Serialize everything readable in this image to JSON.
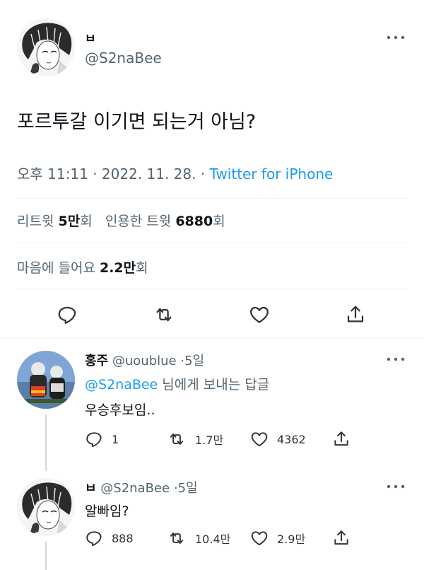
{
  "main_tweet": {
    "display_name": "ㅂ",
    "handle": "@S2naBee",
    "text": "포르투갈 이기면 되는거 아님?",
    "time": "오후 11:11",
    "sep1": "·",
    "date": "2022. 11. 28.",
    "sep2": "·",
    "source": "Twitter for iPhone",
    "retweets_label": "리트윗",
    "retweets_count": "5만",
    "retweets_suffix": "회",
    "quotes_label": "인용한 트윗",
    "quotes_count": "6880",
    "quotes_suffix": "회",
    "likes_label": "마음에 들어요",
    "likes_count": "2.2만",
    "likes_suffix": "회"
  },
  "reply1": {
    "display_name": "홍주",
    "handle": "@uoublue",
    "sep": "·",
    "time": "5일",
    "reply_to_handle": "@S2naBee",
    "reply_to_suffix": "님에게 보내는 답글",
    "text": "우승후보임..",
    "reply_count": "1",
    "retweet_count": "1.7만",
    "like_count": "4362"
  },
  "reply2": {
    "display_name": "ㅂ",
    "handle": "@S2naBee",
    "sep": "·",
    "time": "5일",
    "text": "알빠임?",
    "reply_count": "888",
    "retweet_count": "10.4만",
    "like_count": "2.9만"
  },
  "colors": {
    "link": "#1d9bf0",
    "secondary": "#536471",
    "divider": "#eff3f4",
    "icon": "#2f3336"
  },
  "icons": [
    "more-icon",
    "reply-icon",
    "retweet-icon",
    "like-icon",
    "share-icon"
  ]
}
